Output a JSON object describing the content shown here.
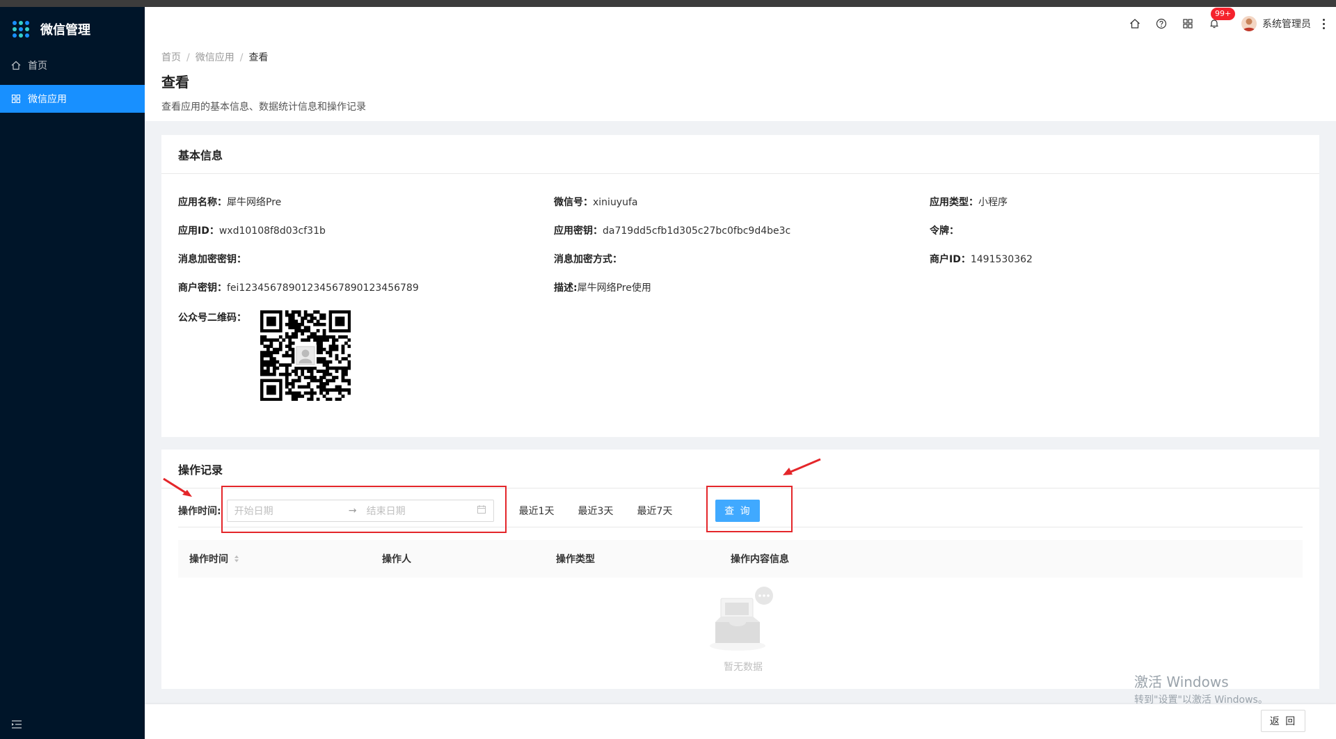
{
  "app": {
    "title": "微信管理"
  },
  "sidebar": {
    "items": [
      {
        "label": "首页",
        "icon": "home-icon"
      },
      {
        "label": "微信应用",
        "icon": "appstore-icon",
        "active": true
      }
    ]
  },
  "header": {
    "notification_count": "99+",
    "username": "系统管理员"
  },
  "breadcrumb": [
    "首页",
    "微信应用",
    "查看"
  ],
  "page": {
    "title": "查看",
    "description": "查看应用的基本信息、数据统计信息和操作记录"
  },
  "basic_info": {
    "title": "基本信息",
    "rows": [
      [
        {
          "label": "应用名称：",
          "value": "犀牛网络Pre"
        },
        {
          "label": "微信号：",
          "value": "xiniuyufa"
        },
        {
          "label": "应用类型：",
          "value": "小程序"
        }
      ],
      [
        {
          "label": "应用ID：",
          "value": "wxd10108f8d03cf31b"
        },
        {
          "label": "应用密钥：",
          "value": "da719dd5cfb1d305c27bc0fbc9d4be3c"
        },
        {
          "label": "令牌：",
          "value": ""
        }
      ],
      [
        {
          "label": "消息加密密钥：",
          "value": ""
        },
        {
          "label": "消息加密方式：",
          "value": ""
        },
        {
          "label": "商户ID：",
          "value": "1491530362"
        }
      ],
      [
        {
          "label": "商户密钥：",
          "value": "fei12345678901234567890123456789"
        },
        {
          "label": "描述:",
          "value": "犀牛网络Pre使用"
        },
        {
          "label": "",
          "value": ""
        }
      ]
    ],
    "qr_label": "公众号二维码："
  },
  "operation_log": {
    "title": "操作记录",
    "filter_label": "操作时间:",
    "start_placeholder": "开始日期",
    "end_placeholder": "结束日期",
    "quick_ranges": [
      "最近1天",
      "最近3天",
      "最近7天"
    ],
    "query_button": "查 询",
    "columns": [
      "操作时间",
      "操作人",
      "操作类型",
      "操作内容信息"
    ],
    "empty_text": "暂无数据"
  },
  "footer": {
    "back_button": "返 回"
  },
  "watermark": {
    "line1": "激活 Windows",
    "line2": "转到\"设置\"以激活 Windows。"
  },
  "colors": {
    "sidebar_bg": "#001529",
    "primary": "#1890ff",
    "annotation_red": "#e4262a"
  }
}
